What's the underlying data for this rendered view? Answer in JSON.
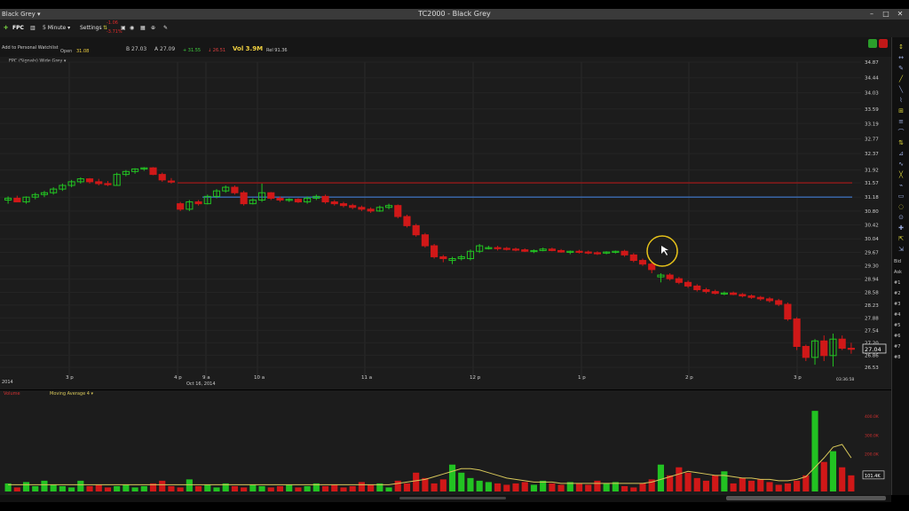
{
  "window": {
    "title": "TC2000 - Black Grey",
    "menu_label": "Black Grey ▾",
    "controls": [
      "–",
      "□",
      "✕"
    ]
  },
  "toolbar": {
    "symbol": "FPC",
    "timeframe": "5 Minute ▾",
    "settings": "Settings",
    "price_tag_top": "-1.06",
    "price_tag_bottom": "-3.71%"
  },
  "quote": {
    "watchlist_link": "Add to Personal Watchlist",
    "open_label": "Open",
    "open_value": "31.08",
    "bid": "B 27.03",
    "ask": "A 27.09",
    "high": "+ 31.55",
    "low": "↓ 26.51",
    "volume": "Vol 3.9M",
    "range": "Rel 91.36"
  },
  "chart": {
    "indicator_label": "FPC (Signals) Wide Grey ▾",
    "price_tag": "27.04",
    "y_ticks": [
      "34.87",
      "34.44",
      "34.03",
      "33.59",
      "33.19",
      "32.77",
      "32.37",
      "31.92",
      "31.57",
      "31.18",
      "30.80",
      "30.42",
      "30.04",
      "29.67",
      "29.30",
      "28.94",
      "28.58",
      "28.23",
      "27.88",
      "27.54",
      "27.20",
      "26.86",
      "26.53"
    ],
    "x_ticks": [
      {
        "label": "3 p",
        "x": 78
      },
      {
        "label": "4 p",
        "x": 200
      },
      {
        "label": "9 a",
        "x": 232
      },
      {
        "label": "10 a",
        "x": 290
      },
      {
        "label": "11 a",
        "x": 411
      },
      {
        "label": "12 p",
        "x": 533
      },
      {
        "label": "1 p",
        "x": 655
      },
      {
        "label": "2 p",
        "x": 776
      },
      {
        "label": "3 p",
        "x": 898
      }
    ],
    "date_left": "2014",
    "date_mid": "Oct 16, 2014",
    "time_right": "03:36:58",
    "red_line_level": 31.57,
    "blue_line_level": 31.18
  },
  "chart_data": {
    "type": "candlestick",
    "title": "FPC",
    "ylim": [
      26.53,
      34.87
    ],
    "candles": [
      [
        31.1,
        31.2,
        31.0,
        31.15
      ],
      [
        31.15,
        31.22,
        31.05,
        31.05
      ],
      [
        31.05,
        31.2,
        31.0,
        31.18
      ],
      [
        31.18,
        31.3,
        31.12,
        31.25
      ],
      [
        31.25,
        31.35,
        31.18,
        31.3
      ],
      [
        31.3,
        31.45,
        31.25,
        31.4
      ],
      [
        31.4,
        31.55,
        31.35,
        31.5
      ],
      [
        31.5,
        31.65,
        31.45,
        31.6
      ],
      [
        31.6,
        31.72,
        31.55,
        31.68
      ],
      [
        31.68,
        31.7,
        31.55,
        31.6
      ],
      [
        31.6,
        31.68,
        31.5,
        31.55
      ],
      [
        31.55,
        31.62,
        31.48,
        31.52
      ],
      [
        31.5,
        31.85,
        31.5,
        31.8
      ],
      [
        31.8,
        31.92,
        31.75,
        31.88
      ],
      [
        31.88,
        31.97,
        31.82,
        31.95
      ],
      [
        31.95,
        32.0,
        31.9,
        31.98
      ],
      [
        31.98,
        32.0,
        31.78,
        31.8
      ],
      [
        31.8,
        31.85,
        31.6,
        31.65
      ],
      [
        31.62,
        31.7,
        31.55,
        31.6
      ],
      [
        31.0,
        31.05,
        30.8,
        30.85
      ],
      [
        30.85,
        31.1,
        30.8,
        31.05
      ],
      [
        31.05,
        31.1,
        30.95,
        31.0
      ],
      [
        31.0,
        31.25,
        30.98,
        31.2
      ],
      [
        31.2,
        31.4,
        31.15,
        31.35
      ],
      [
        31.35,
        31.5,
        31.3,
        31.45
      ],
      [
        31.45,
        31.5,
        31.25,
        31.3
      ],
      [
        31.3,
        31.35,
        30.95,
        31.0
      ],
      [
        31.0,
        31.15,
        30.98,
        31.1
      ],
      [
        31.1,
        31.55,
        31.05,
        31.3
      ],
      [
        31.3,
        31.32,
        31.1,
        31.15
      ],
      [
        31.15,
        31.2,
        31.05,
        31.1
      ],
      [
        31.1,
        31.15,
        31.05,
        31.12
      ],
      [
        31.12,
        31.15,
        31.02,
        31.05
      ],
      [
        31.05,
        31.2,
        31.0,
        31.15
      ],
      [
        31.15,
        31.25,
        31.1,
        31.2
      ],
      [
        31.2,
        31.25,
        31.0,
        31.05
      ],
      [
        31.05,
        31.1,
        30.95,
        31.0
      ],
      [
        31.0,
        31.05,
        30.9,
        30.95
      ],
      [
        30.95,
        31.0,
        30.85,
        30.9
      ],
      [
        30.9,
        30.95,
        30.8,
        30.85
      ],
      [
        30.85,
        30.9,
        30.75,
        30.8
      ],
      [
        30.8,
        30.95,
        30.78,
        30.9
      ],
      [
        30.9,
        31.0,
        30.85,
        30.95
      ],
      [
        30.95,
        30.98,
        30.6,
        30.65
      ],
      [
        30.65,
        30.7,
        30.35,
        30.4
      ],
      [
        30.4,
        30.45,
        30.1,
        30.15
      ],
      [
        30.15,
        30.2,
        29.8,
        29.85
      ],
      [
        29.85,
        29.9,
        29.5,
        29.55
      ],
      [
        29.55,
        29.6,
        29.4,
        29.5
      ],
      [
        29.45,
        29.55,
        29.35,
        29.5
      ],
      [
        29.5,
        29.6,
        29.45,
        29.55
      ],
      [
        29.5,
        29.75,
        29.45,
        29.7
      ],
      [
        29.7,
        29.9,
        29.65,
        29.85
      ],
      [
        29.8,
        29.85,
        29.75,
        29.8
      ],
      [
        29.8,
        29.85,
        29.72,
        29.78
      ],
      [
        29.78,
        29.82,
        29.72,
        29.76
      ],
      [
        29.76,
        29.8,
        29.7,
        29.74
      ],
      [
        29.74,
        29.78,
        29.68,
        29.7
      ],
      [
        29.7,
        29.75,
        29.65,
        29.72
      ],
      [
        29.72,
        29.8,
        29.7,
        29.76
      ],
      [
        29.76,
        29.8,
        29.7,
        29.72
      ],
      [
        29.72,
        29.76,
        29.66,
        29.68
      ],
      [
        29.68,
        29.72,
        29.62,
        29.7
      ],
      [
        29.7,
        29.74,
        29.64,
        29.68
      ],
      [
        29.68,
        29.72,
        29.62,
        29.66
      ],
      [
        29.66,
        29.7,
        29.6,
        29.65
      ],
      [
        29.65,
        29.7,
        29.62,
        29.68
      ],
      [
        29.68,
        29.72,
        29.64,
        29.7
      ],
      [
        29.7,
        29.74,
        29.55,
        29.6
      ],
      [
        29.6,
        29.65,
        29.4,
        29.45
      ],
      [
        29.45,
        29.5,
        29.3,
        29.35
      ],
      [
        29.35,
        29.4,
        29.1,
        29.2
      ],
      [
        29.0,
        29.1,
        28.85,
        29.05
      ],
      [
        29.05,
        29.1,
        28.9,
        28.95
      ],
      [
        28.95,
        29.0,
        28.8,
        28.85
      ],
      [
        28.85,
        28.9,
        28.7,
        28.75
      ],
      [
        28.75,
        28.8,
        28.6,
        28.65
      ],
      [
        28.65,
        28.7,
        28.55,
        28.6
      ],
      [
        28.6,
        28.65,
        28.52,
        28.55
      ],
      [
        28.55,
        28.6,
        28.5,
        28.56
      ],
      [
        28.56,
        28.6,
        28.5,
        28.52
      ],
      [
        28.52,
        28.56,
        28.44,
        28.48
      ],
      [
        28.48,
        28.52,
        28.4,
        28.44
      ],
      [
        28.44,
        28.48,
        28.35,
        28.4
      ],
      [
        28.4,
        28.45,
        28.3,
        28.35
      ],
      [
        28.35,
        28.4,
        28.2,
        28.25
      ],
      [
        28.25,
        28.3,
        27.8,
        27.85
      ],
      [
        27.85,
        27.9,
        27.0,
        27.1
      ],
      [
        27.1,
        27.15,
        26.7,
        26.8
      ],
      [
        26.8,
        27.3,
        26.6,
        27.25
      ],
      [
        27.25,
        27.4,
        26.7,
        26.85
      ],
      [
        26.85,
        27.45,
        26.55,
        27.3
      ],
      [
        27.3,
        27.4,
        27.0,
        27.05
      ],
      [
        27.05,
        27.2,
        26.9,
        27.04
      ]
    ],
    "volume": [
      6,
      3,
      7,
      4,
      8,
      5,
      4,
      3,
      8,
      4,
      5,
      3,
      4,
      5,
      3,
      4,
      6,
      8,
      4,
      3,
      9,
      4,
      5,
      3,
      6,
      4,
      3,
      5,
      4,
      3,
      4,
      5,
      3,
      4,
      6,
      4,
      5,
      3,
      4,
      7,
      5,
      6,
      3,
      8,
      6,
      14,
      10,
      6,
      9,
      20,
      14,
      10,
      8,
      7,
      6,
      5,
      6,
      7,
      5,
      8,
      6,
      5,
      7,
      6,
      5,
      8,
      6,
      7,
      4,
      3,
      6,
      9,
      20,
      12,
      18,
      14,
      10,
      8,
      12,
      15,
      6,
      10,
      8,
      9,
      7,
      5,
      6,
      8,
      12,
      60,
      22,
      30,
      18,
      12
    ],
    "vol_ma": [
      5,
      5,
      5,
      5,
      5,
      5,
      5,
      5,
      5,
      5,
      5,
      5,
      5,
      5,
      5,
      5,
      5,
      5,
      5,
      5,
      5,
      5,
      5,
      5,
      5,
      5,
      5,
      5,
      5,
      5,
      5,
      5,
      5,
      5,
      5,
      5,
      5,
      5,
      5,
      5,
      5,
      5,
      5,
      6,
      7,
      8,
      9,
      11,
      13,
      15,
      17,
      17,
      16,
      14,
      12,
      10,
      9,
      8,
      7,
      7,
      7,
      6,
      6,
      6,
      6,
      6,
      6,
      6,
      6,
      6,
      6,
      7,
      9,
      11,
      13,
      15,
      14,
      13,
      12,
      12,
      11,
      10,
      10,
      9,
      9,
      8,
      8,
      9,
      11,
      18,
      25,
      33,
      35,
      25
    ],
    "volume_ylim": [
      0,
      70
    ],
    "volume_ticks": [
      "400.0K",
      "300.0K",
      "200.0K",
      "100.0K"
    ],
    "volume_tag": "101.4K",
    "volume_legend": [
      "Volume",
      "Moving Average 4 ▾"
    ]
  },
  "right_panel": {
    "items": [
      "Bid",
      "Ask",
      "#1",
      "#2",
      "#3",
      "#4",
      "#5",
      "#6",
      "#7",
      "#8"
    ]
  },
  "colors": {
    "up": "#22c222",
    "down": "#d01818",
    "red_line": "#8a1a1a",
    "blue_line": "#3b6db5",
    "ma_line": "#d8c85a",
    "cursor_ring": "#e6c21a"
  }
}
